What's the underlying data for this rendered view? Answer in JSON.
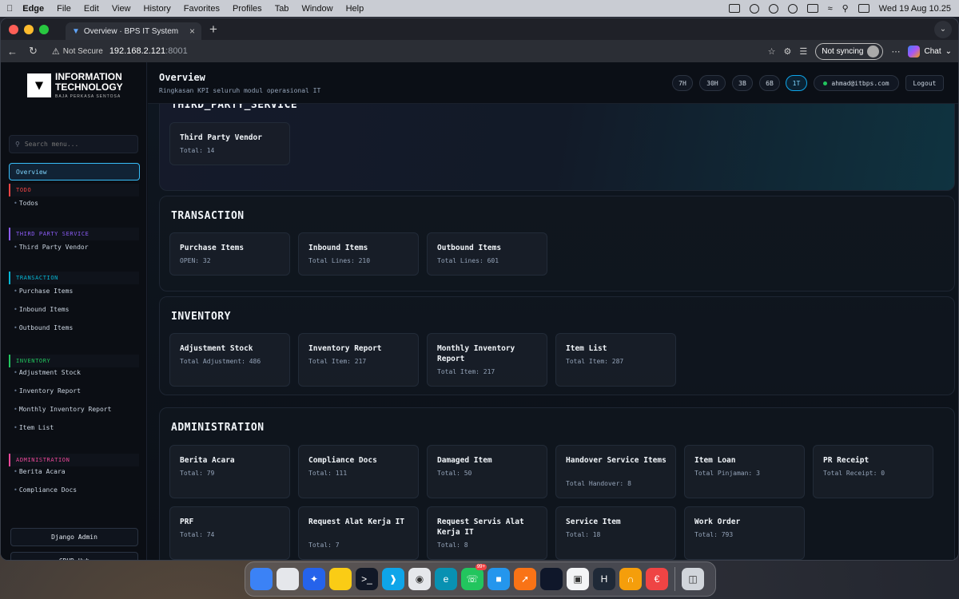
{
  "menubar": {
    "app": "Edge",
    "items": [
      "File",
      "Edit",
      "View",
      "History",
      "Favorites",
      "Profiles",
      "Tab",
      "Window",
      "Help"
    ],
    "datetime": "Wed 19 Aug  10.25"
  },
  "browser": {
    "tab_title": "Overview · BPS IT System",
    "security_label": "Not Secure",
    "url_host": "192.168.2.121",
    "url_port": ":8001",
    "sync_label": "Not syncing",
    "chat_label": "Chat"
  },
  "sidebar": {
    "logo_line1": "INFORMATION",
    "logo_line2": "TECHNOLOGY",
    "logo_sub": "BAJA PERKASA SENTOSA",
    "search_placeholder": "Search menu...",
    "overview": "Overview",
    "sections": [
      {
        "label": "TODO",
        "color": "#ef4444",
        "items": [
          "Todos"
        ]
      },
      {
        "label": "THIRD PARTY SERVICE",
        "color": "#8b5cf6",
        "items": [
          "Third Party Vendor"
        ]
      },
      {
        "label": "TRANSACTION",
        "color": "#06b6d4",
        "items": [
          "Purchase Items",
          "Inbound Items",
          "Outbound Items"
        ]
      },
      {
        "label": "INVENTORY",
        "color": "#22c55e",
        "items": [
          "Adjustment Stock",
          "Inventory Report",
          "Monthly Inventory Report",
          "Item List"
        ]
      },
      {
        "label": "ADMINISTRATION",
        "color": "#ec4899",
        "items": [
          "Berita Acara",
          "Compliance Docs"
        ]
      }
    ],
    "django_admin": "Django Admin",
    "crud_hub": "CRUD Hub"
  },
  "header": {
    "title": "Overview",
    "subtitle": "Ringkasan KPI seluruh modul operasional IT",
    "ranges": [
      "7H",
      "30H",
      "3B",
      "6B",
      "1T"
    ],
    "active_range": "1T",
    "user_email": "ahmad@itbps.com",
    "logout": "Logout"
  },
  "sections": [
    {
      "title": "THIRD_PARTY_SERVICE",
      "cards": [
        {
          "title": "Third Party Vendor",
          "value": "Total: 14"
        }
      ]
    },
    {
      "title": "TRANSACTION",
      "cards": [
        {
          "title": "Purchase Items",
          "value": "OPEN: 32"
        },
        {
          "title": "Inbound Items",
          "value": "Total Lines: 210"
        },
        {
          "title": "Outbound Items",
          "value": "Total Lines: 601"
        }
      ]
    },
    {
      "title": "INVENTORY",
      "cards": [
        {
          "title": "Adjustment Stock",
          "value": "Total Adjustment: 486"
        },
        {
          "title": "Inventory Report",
          "value": "Total Item: 217"
        },
        {
          "title": "Monthly Inventory Report",
          "value": "Total Item: 217"
        },
        {
          "title": "Item List",
          "value": "Total Item: 287"
        }
      ]
    },
    {
      "title": "ADMINISTRATION",
      "cards": [
        {
          "title": "Berita Acara",
          "value": "Total: 79"
        },
        {
          "title": "Compliance Docs",
          "value": "Total: 111"
        },
        {
          "title": "Damaged Item",
          "value": "Total: 50"
        },
        {
          "title": "Handover Service Items",
          "value": "Total Handover: 8"
        },
        {
          "title": "Item Loan",
          "value": "Total Pinjaman: 3"
        },
        {
          "title": "PR Receipt",
          "value": "Total Receipt: 0"
        },
        {
          "title": "PRF",
          "value": "Total: 74"
        },
        {
          "title": "Request Alat Kerja IT",
          "value": "Total: 7"
        },
        {
          "title": "Request Servis Alat Kerja IT",
          "value": "Total: 8"
        },
        {
          "title": "Service Item",
          "value": "Total: 18"
        },
        {
          "title": "Work Order",
          "value": "Total: 793"
        }
      ]
    }
  ],
  "dock": {
    "icons": [
      "finder-icon",
      "launchpad-icon",
      "safari-icon",
      "notes-icon",
      "terminal-icon",
      "vscode-icon",
      "chrome-icon",
      "edge-icon",
      "whatsapp-icon",
      "docker-icon",
      "postman-icon",
      "pycharm-icon",
      "preview-icon",
      "hoppscotch-icon",
      "git-icon",
      "app-icon",
      "trash-icon"
    ],
    "whatsapp_badge": "99+"
  }
}
